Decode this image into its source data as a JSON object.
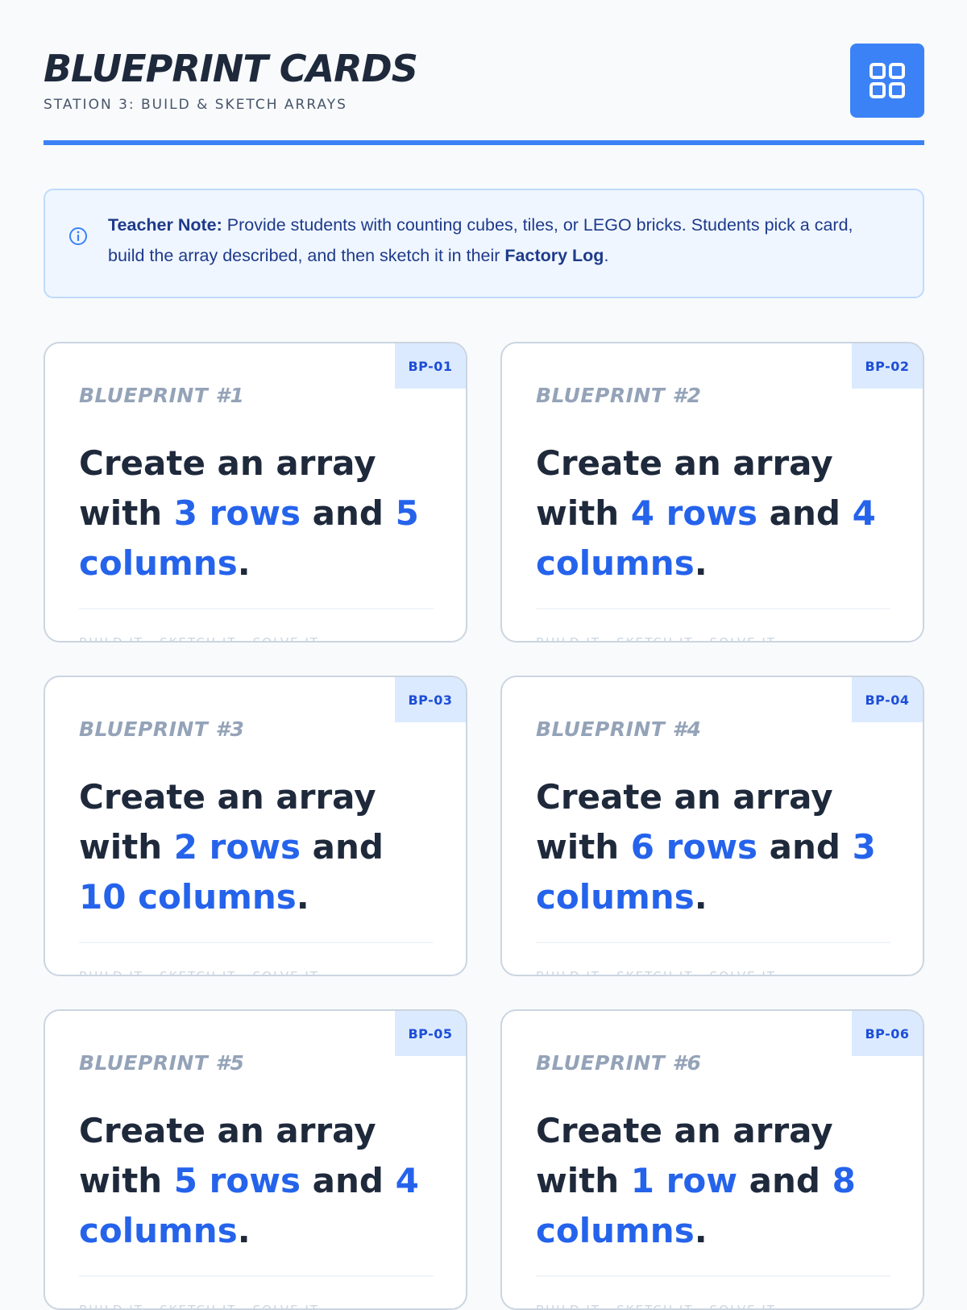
{
  "header": {
    "title": "BLUEPRINT CARDS",
    "subtitle": "STATION 3: BUILD & SKETCH ARRAYS",
    "grid_icon": "grid-icon"
  },
  "note": {
    "icon": "info-icon",
    "label": "Teacher Note:",
    "text_before": " Provide students with counting cubes, tiles, or LEGO bricks. Students pick a card, build the array described, and then sketch it in their ",
    "emphasis": "Factory Log",
    "text_after": "."
  },
  "cards": [
    {
      "badge": "BP-01",
      "label": "BLUEPRINT #1",
      "prefix": "Create an array with ",
      "rows": "3 rows",
      "joiner": " and ",
      "cols": "5 columns",
      "suffix": ".",
      "footer": "BUILD IT · SKETCH IT · SOLVE IT"
    },
    {
      "badge": "BP-02",
      "label": "BLUEPRINT #2",
      "prefix": "Create an array with ",
      "rows": "4 rows",
      "joiner": " and ",
      "cols": "4 columns",
      "suffix": ".",
      "footer": "BUILD IT · SKETCH IT · SOLVE IT"
    },
    {
      "badge": "BP-03",
      "label": "BLUEPRINT #3",
      "prefix": "Create an array with ",
      "rows": "2 rows",
      "joiner": " and ",
      "cols": "10 columns",
      "suffix": ".",
      "footer": "BUILD IT · SKETCH IT · SOLVE IT"
    },
    {
      "badge": "BP-04",
      "label": "BLUEPRINT #4",
      "prefix": "Create an array with ",
      "rows": "6 rows",
      "joiner": " and ",
      "cols": "3 columns",
      "suffix": ".",
      "footer": "BUILD IT · SKETCH IT · SOLVE IT"
    },
    {
      "badge": "BP-05",
      "label": "BLUEPRINT #5",
      "prefix": "Create an array with ",
      "rows": "5 rows",
      "joiner": " and ",
      "cols": "4 columns",
      "suffix": ".",
      "footer": "BUILD IT · SKETCH IT · SOLVE IT"
    },
    {
      "badge": "BP-06",
      "label": "BLUEPRINT #6",
      "prefix": "Create an array with ",
      "rows": "1 row",
      "joiner": " and ",
      "cols": "8 columns",
      "suffix": ".",
      "footer": "BUILD IT · SKETCH IT · SOLVE IT"
    }
  ]
}
